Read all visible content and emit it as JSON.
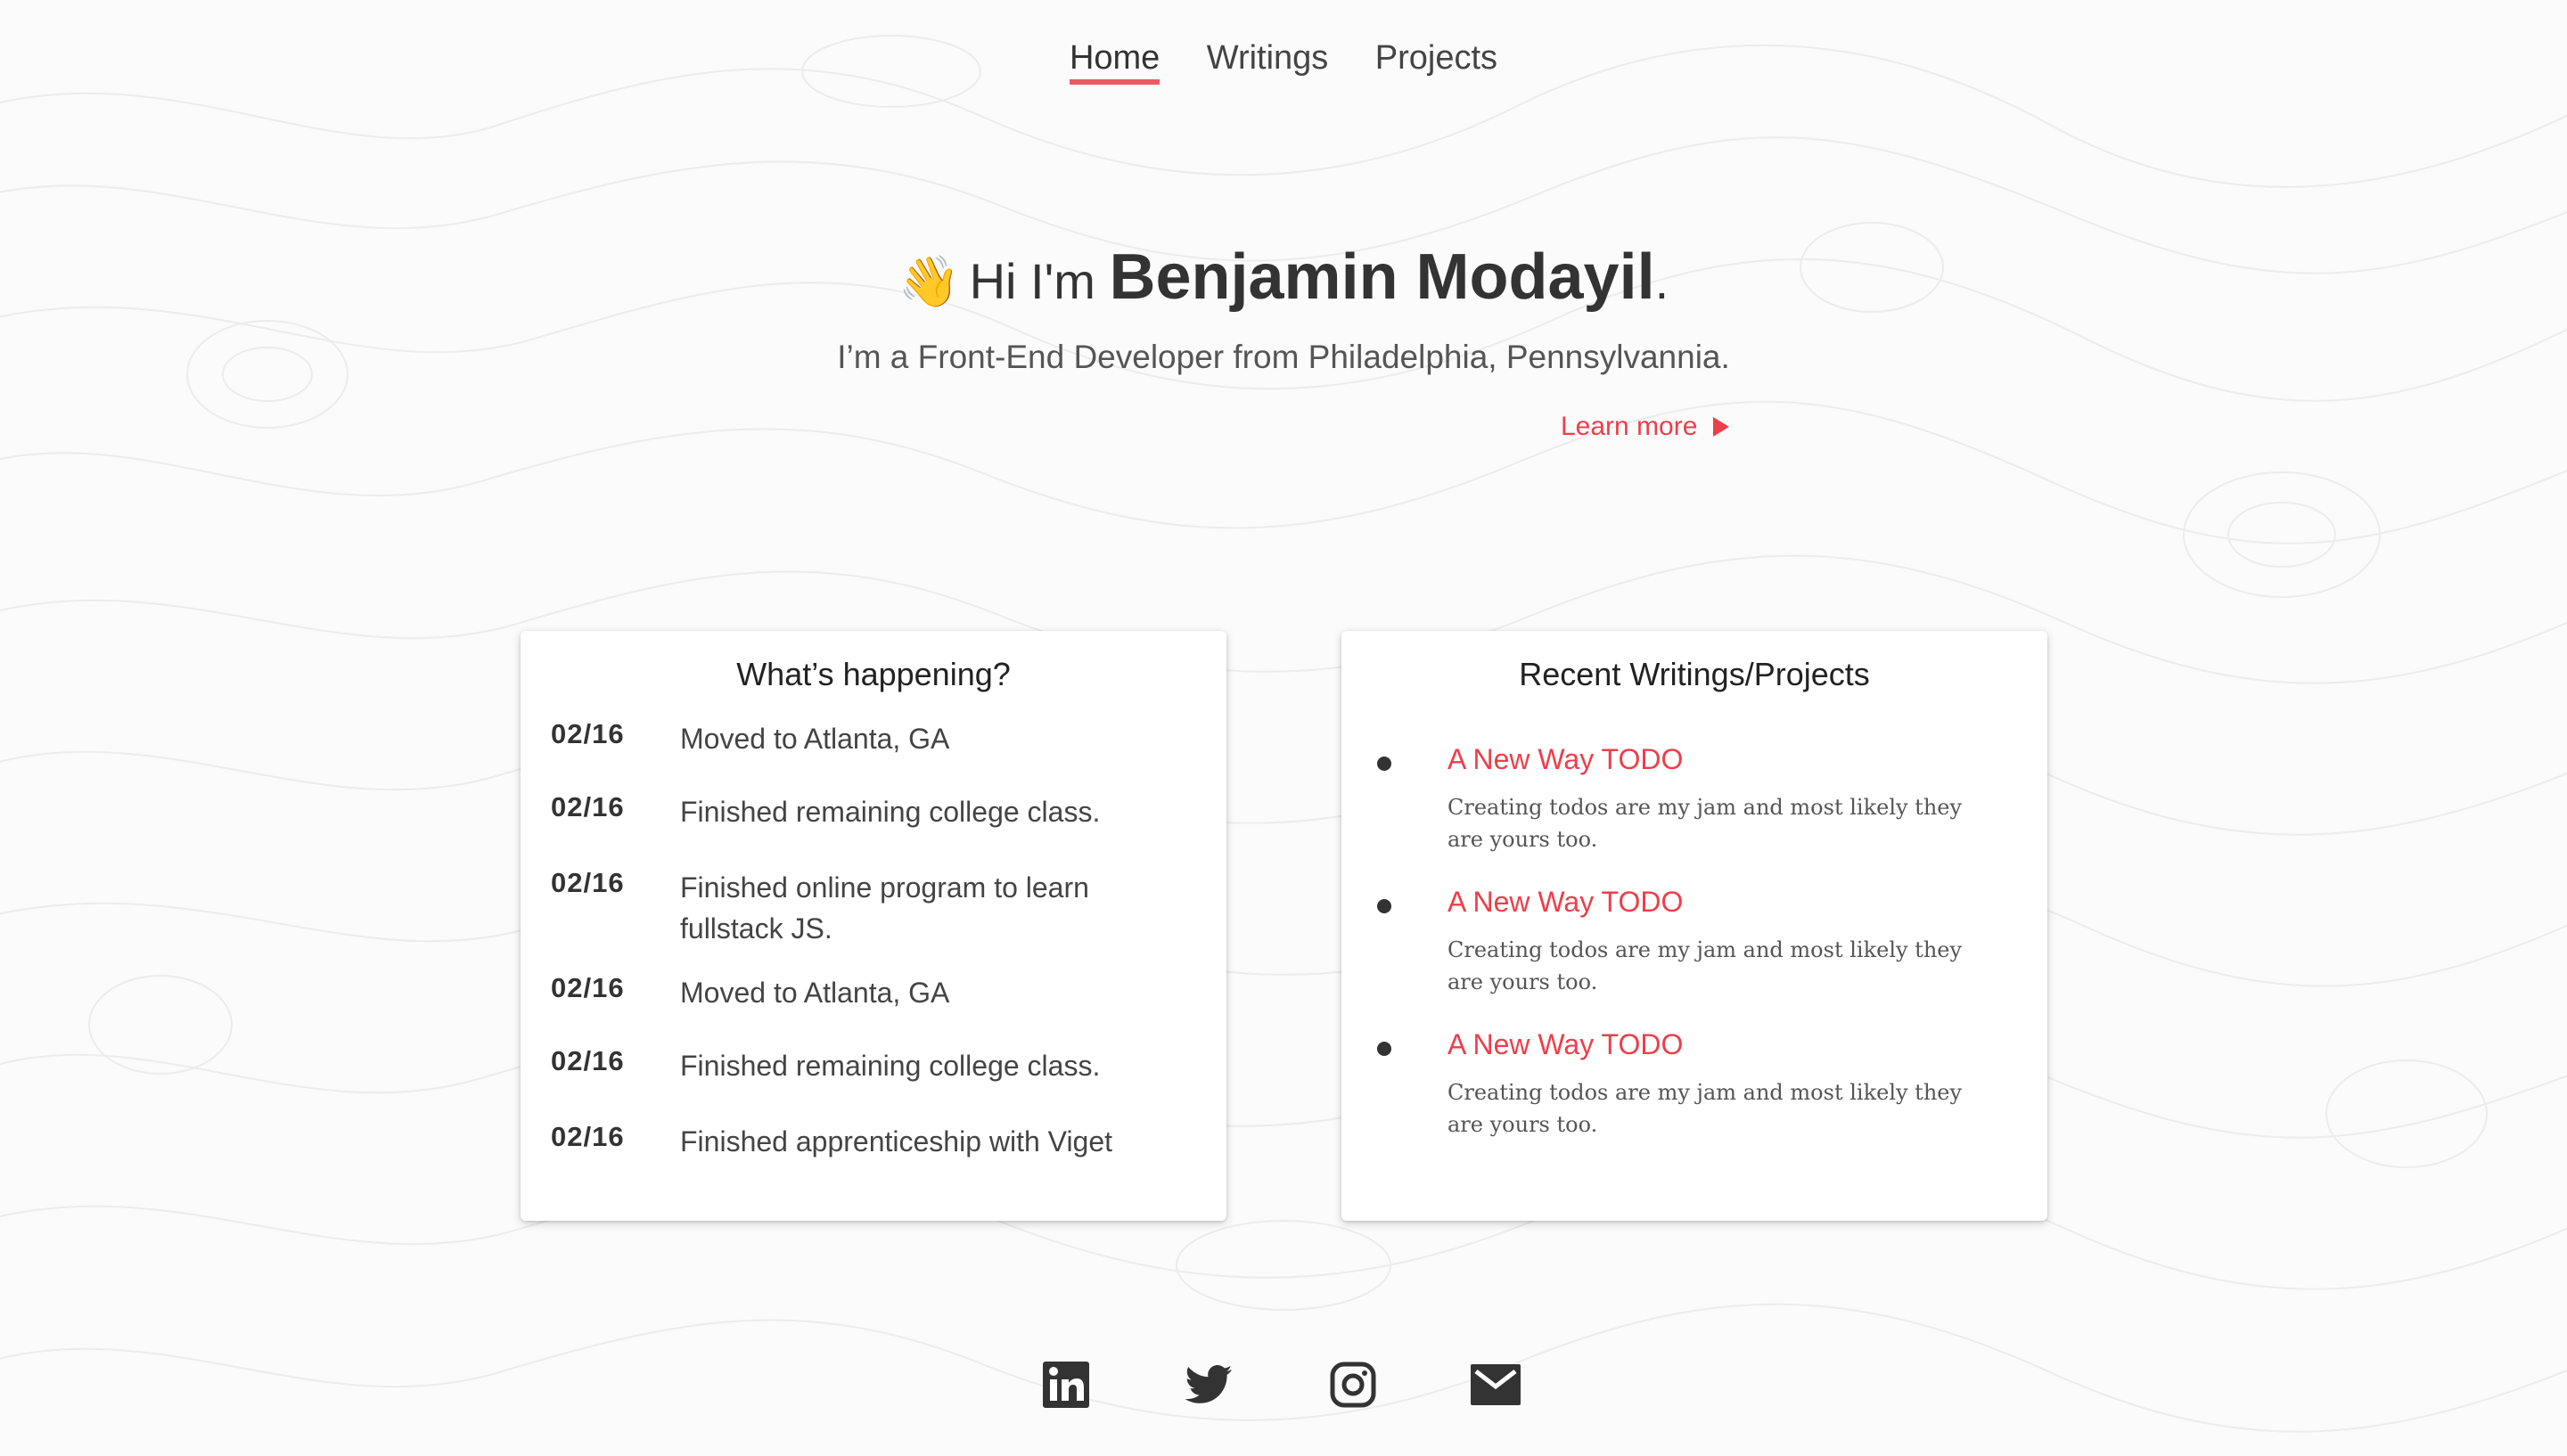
{
  "nav": {
    "items": [
      {
        "label": "Home",
        "active": true
      },
      {
        "label": "Writings",
        "active": false
      },
      {
        "label": "Projects",
        "active": false
      }
    ]
  },
  "hero": {
    "wave_emoji": "👋",
    "greeting": "Hi I'm ",
    "name": "Benjamin Modayil",
    "period": ".",
    "subtitle": "I’m a Front-End Developer from Philadelphia, Pennsylvannia.",
    "learn_more": "Learn more"
  },
  "happening": {
    "title": "What’s happening?",
    "events": [
      {
        "date": "02/16",
        "text": "Moved to Atlanta, GA"
      },
      {
        "date": "02/16",
        "text": "Finished remaining college class."
      },
      {
        "date": "02/16",
        "text": "Finished online program to learn fullstack JS."
      },
      {
        "date": "02/16",
        "text": "Moved to Atlanta, GA"
      },
      {
        "date": "02/16",
        "text": "Finished remaining college class."
      },
      {
        "date": "02/16",
        "text": "Finished apprenticeship with Viget"
      }
    ]
  },
  "recent": {
    "title": "Recent Writings/Projects",
    "posts": [
      {
        "title": "A New Way TODO",
        "desc": "Creating todos are my jam and most likely they are yours too."
      },
      {
        "title": "A New Way TODO",
        "desc": "Creating todos are my jam and most likely they are yours too."
      },
      {
        "title": "A New Way TODO",
        "desc": "Creating todos are my jam and most likely they are yours too."
      }
    ]
  },
  "social": [
    {
      "icon": "linkedin-icon"
    },
    {
      "icon": "twitter-icon"
    },
    {
      "icon": "instagram-icon"
    },
    {
      "icon": "email-icon"
    }
  ],
  "colors": {
    "accent": "#ee3e4a",
    "nav_underline": "#ee5a63",
    "text": "#333333",
    "background": "#fbfbfb"
  }
}
